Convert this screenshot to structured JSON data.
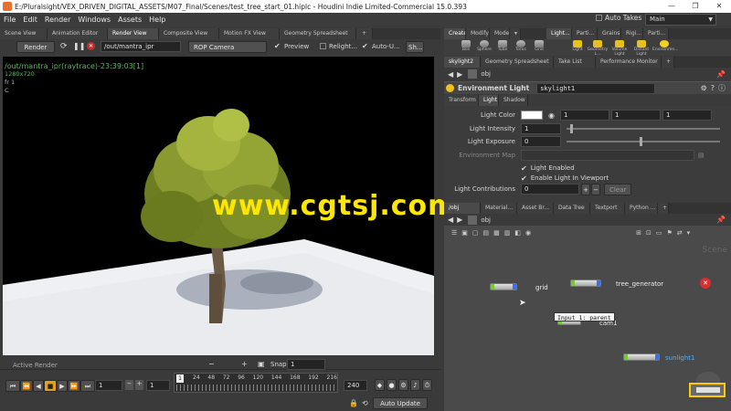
{
  "titlebar": {
    "title": "E:/Pluralsight/VEX_DRIVEN_DIGITAL_ASSETS/M07_Final/Scenes/test_tree_start_01.hiplc - Houdini Indie Limited-Commercial 15.0.393"
  },
  "menu": [
    "File",
    "Edit",
    "Render",
    "Windows",
    "Assets",
    "Help"
  ],
  "autotakes": "Auto Takes",
  "desktop": "Main",
  "left_tabs": [
    "Scene View",
    "Animation Editor",
    "Render View",
    "Composite View",
    "Motion FX View",
    "Geometry Spreadsheet"
  ],
  "toolbar": {
    "render_label": "Render",
    "rop_path": "/out/mantra_ipr",
    "camera": "ROP Camera",
    "preview": "Preview",
    "relight": "Relight...",
    "autou": "Auto-U...",
    "sh": "Sh..."
  },
  "viewport": {
    "line1": "/out/mantra_ipr(raytrace)-23:39:03[1]",
    "line2": "1280x720",
    "line3": "fr 1",
    "line4": "C"
  },
  "watermark": "www.cgtsj.com",
  "timeline": {
    "active_render": "Active Render",
    "snap_label": "Snap",
    "snap_value": "1",
    "frame_start": "1",
    "frame_cur": "1",
    "frame_end": "240",
    "current": "1",
    "ticks": [
      "24",
      "48",
      "72",
      "96",
      "120",
      "144",
      "168",
      "192",
      "216"
    ],
    "auto_update": "Auto Update"
  },
  "shelf_tabs": [
    "Create",
    "Modify",
    "Model",
    "Light...",
    "Parti...",
    "Grains",
    "Rigi...",
    "Parti..."
  ],
  "shelf_tools": [
    "Box",
    "Sphere",
    "Tube",
    "Torus",
    "Grid",
    "Light",
    "Geometry L...",
    "Volume Light",
    "Distant Light",
    "Environme..."
  ],
  "right_tabs2": [
    "skylight2",
    "Geometry Spreadsheet",
    "Take List",
    "Performance Monitor"
  ],
  "path1": "obj",
  "param_header": {
    "type": "Environment Light",
    "name": "skylight1"
  },
  "param_tabs": [
    "Transform",
    "Light",
    "Shadow"
  ],
  "params": {
    "light_color": {
      "label": "Light Color",
      "r": "1",
      "g": "1",
      "b": "1"
    },
    "light_intensity": {
      "label": "Light Intensity",
      "value": "1"
    },
    "light_exposure": {
      "label": "Light Exposure",
      "value": "0"
    },
    "environment_map": {
      "label": "Environment Map"
    },
    "light_enabled": {
      "label": "Light Enabled"
    },
    "enable_in_viewport": {
      "label": "Enable Light In Viewport"
    },
    "light_contributions": {
      "label": "Light Contributions",
      "value": "0",
      "clear": "Clear"
    }
  },
  "network_tabs": [
    "/obj",
    "Material...",
    "Asset Br...",
    "Data Tree",
    "Textport",
    "Python ..."
  ],
  "path2": "obj",
  "scene_label": "Scene",
  "nodes": {
    "grid": "grid",
    "tree_generator": "tree_generator",
    "cam1": "cam1",
    "sunlight1": "sunlight1",
    "tooltip": "Input 1: parent"
  },
  "colors": {
    "accent": "#ffcc00",
    "node_in": "#6fcf2a",
    "node_out": "#3a6ff0",
    "viewport_text": "#5fb35f",
    "watermark": "#ffe600"
  }
}
